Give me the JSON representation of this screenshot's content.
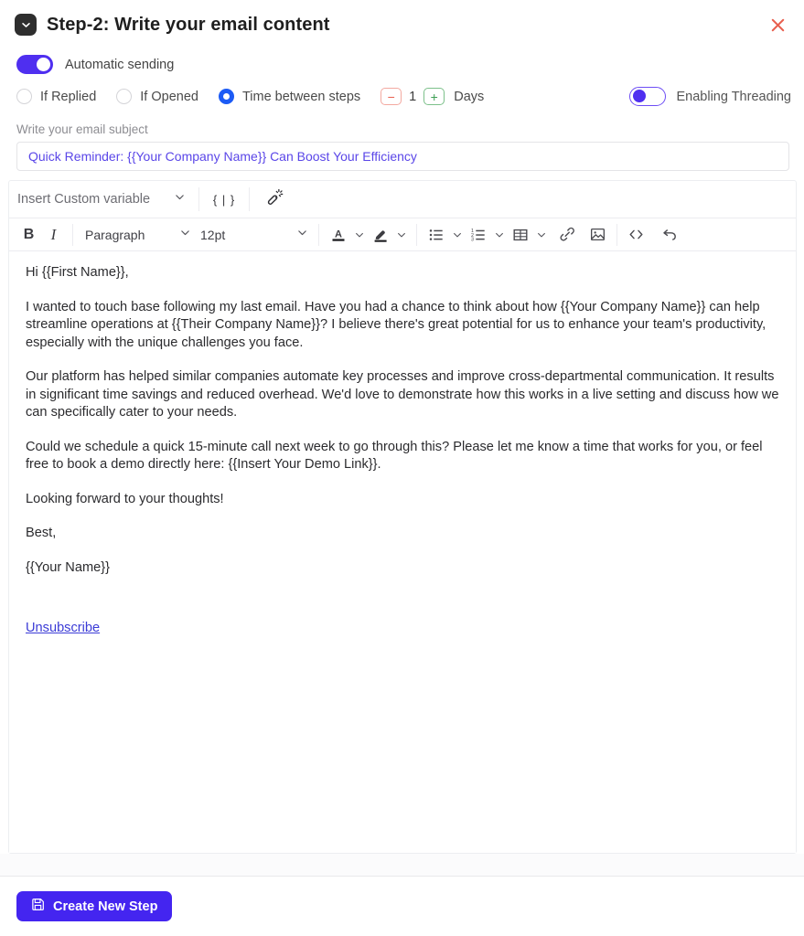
{
  "header": {
    "title": "Step-2: Write your email content",
    "mail_icon": "mail-chevron-icon",
    "close_icon": "close-icon"
  },
  "automatic_sending": {
    "label": "Automatic sending",
    "state": "on"
  },
  "options": {
    "radios": [
      {
        "label": "If Replied",
        "checked": false
      },
      {
        "label": "If Opened",
        "checked": false
      },
      {
        "label": "Time between steps",
        "checked": true
      }
    ],
    "stepper": {
      "minus_label": "−",
      "value": "1",
      "plus_label": "+",
      "unit": "Days"
    },
    "threading": {
      "label": "Enabling Threading",
      "state": "off"
    }
  },
  "subject": {
    "label": "Write your email subject",
    "value": "Quick Reminder: {{Your Company Name}} Can Boost Your Efficiency",
    "placeholder": "Write your email subject"
  },
  "variable_bar": {
    "select_label": "Insert Custom variable",
    "curly_label": "{ | }",
    "wand_icon": "magic-wand-icon",
    "chevron_icon": "chevron-down-icon"
  },
  "format_bar": {
    "bold_label": "B",
    "italic_label": "I",
    "block_format": "Paragraph",
    "font_size": "12pt",
    "text_color_label": "A",
    "icons": [
      "text-color-icon",
      "highlight-color-icon",
      "bullet-list-icon",
      "numbered-list-icon",
      "table-icon",
      "link-icon",
      "image-icon",
      "source-code-icon",
      "undo-icon"
    ]
  },
  "email_body": {
    "paragraphs": [
      "Hi {{First Name}},",
      "I wanted to touch base following my last email. Have you had a chance to think about how {{Your Company Name}} can help streamline operations at {{Their Company Name}}? I believe there's great potential for us to enhance your team's productivity, especially with the unique challenges you face.",
      "Our platform has helped similar companies automate key processes and improve cross-departmental communication. It results in significant time savings and reduced overhead. We'd love to demonstrate how this works in a live setting and discuss how we can specifically cater to your needs.",
      "Could we schedule a quick 15-minute call next week to go through this? Please let me know a time that works for you, or feel free to book a demo directly here: {{Insert Your Demo Link}}.",
      "Looking forward to your thoughts!",
      "Best,",
      "{{Your Name}}"
    ],
    "unsubscribe_label": "Unsubscribe"
  },
  "footer": {
    "create_button_label": "Create New Step",
    "save_icon": "save-icon"
  },
  "colors": {
    "accent_purple": "#4425f0",
    "toggle_purple": "#4f2ff0",
    "radio_blue": "#1c5bf5",
    "subject_text": "#5a46e8",
    "link_blue": "#3b3bd6",
    "close_red": "#e8604f",
    "minus_red": "#e8604f",
    "plus_green": "#3f9f55"
  }
}
